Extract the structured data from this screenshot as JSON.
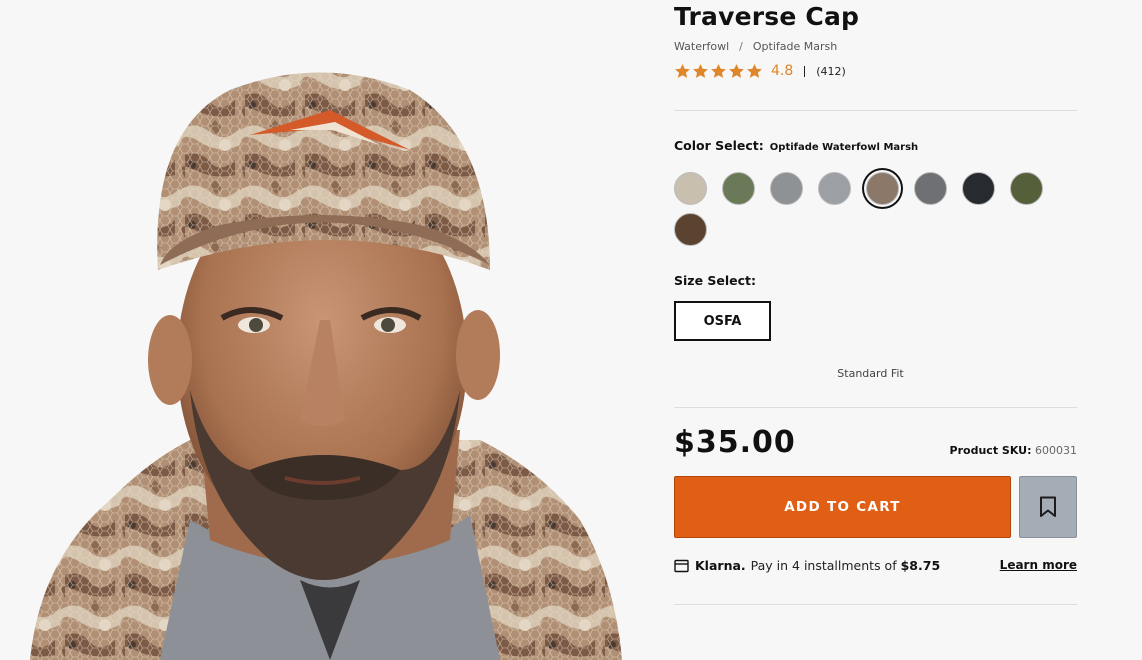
{
  "product": {
    "title": "Traverse Cap",
    "breadcrumb": [
      "Waterfowl",
      "Optifade Marsh"
    ],
    "breadcrumb_separator": "/",
    "rating": {
      "value": "4.8",
      "stars": 5,
      "count": "(412)",
      "star_color": "#e0862a"
    },
    "image_alt": "Man wearing camo Traverse Cap"
  },
  "color_select": {
    "label": "Color Select:",
    "selected_value": "Optifade Waterfowl Marsh",
    "swatches": [
      {
        "name": "light-camo",
        "color": "#c9bfae",
        "selected": false
      },
      {
        "name": "green-camo",
        "color": "#6a7a58",
        "selected": false
      },
      {
        "name": "gray-camo",
        "color": "#8f9294",
        "selected": false
      },
      {
        "name": "snow-gray-camo",
        "color": "#9c9fa3",
        "selected": false
      },
      {
        "name": "marsh-camo",
        "color": "#8b7868",
        "selected": true
      },
      {
        "name": "dark-gray-camo",
        "color": "#6f7073",
        "selected": false
      },
      {
        "name": "black",
        "color": "#272a2e",
        "selected": false
      },
      {
        "name": "olive",
        "color": "#55603a",
        "selected": false
      },
      {
        "name": "brown",
        "color": "#5b4330",
        "selected": false
      }
    ]
  },
  "size_select": {
    "label": "Size Select:",
    "option": "OSFA",
    "fit_note": "Standard Fit"
  },
  "purchase": {
    "price": "$35.00",
    "sku_label": "Product SKU:",
    "sku_value": "600031",
    "add_to_cart_label": "ADD TO CART",
    "accent_color": "#e05f14"
  },
  "klarna": {
    "brand": "Klarna.",
    "text": "Pay in 4 installments of",
    "amount": "$8.75",
    "learn_more": "Learn more"
  }
}
